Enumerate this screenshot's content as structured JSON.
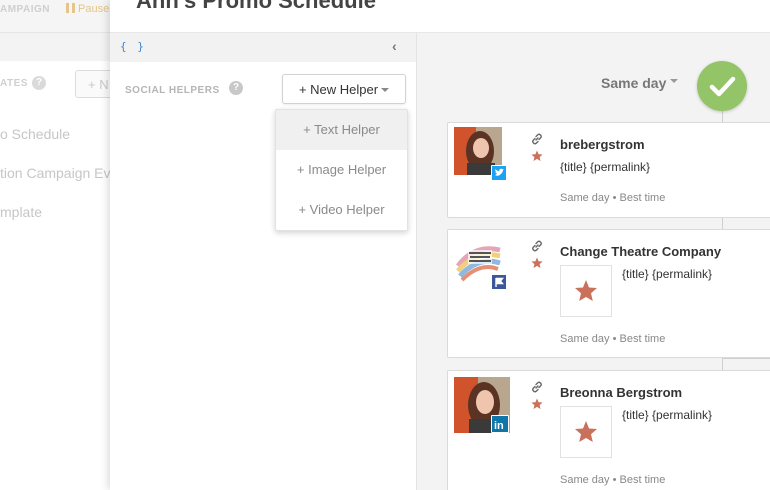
{
  "background": {
    "campaign_label": "AMPAIGN",
    "paused_label": "Pause",
    "templates_label": "ATES",
    "new_button": "+ N",
    "items": [
      "o Schedule",
      "tion Campaign Ev",
      "mplate"
    ]
  },
  "modal": {
    "title": "Ann's Promo Schedule",
    "braces": "{ }"
  },
  "social_helpers": {
    "label": "SOCIAL HELPERS",
    "new_helper_button": "+ New Helper",
    "menu": [
      "+ Text Helper",
      "+ Image Helper",
      "+ Video Helper"
    ]
  },
  "schedule": {
    "filter_label": "Same day",
    "cards": [
      {
        "name": "brebergstrom",
        "text": "{title} {permalink}",
        "meta": "Same day • Best time",
        "network": "twitter",
        "network_color": "#1da1f2"
      },
      {
        "name": "Change Theatre Company",
        "text": "{title} {permalink}",
        "meta": "Same day • Best time",
        "network": "facebook-page",
        "network_color": "#3b5998"
      },
      {
        "name": "Breonna Bergstrom",
        "text": "{title} {permalink}",
        "meta": "Same day • Best time",
        "network": "linkedin",
        "network_color": "#0e76a8"
      }
    ]
  },
  "colors": {
    "accent_green": "#93c467",
    "star": "#c9715a",
    "link_blue": "#3d86d0"
  },
  "icons": {
    "help": "?",
    "collapse": "‹",
    "confirm": "check-icon"
  }
}
